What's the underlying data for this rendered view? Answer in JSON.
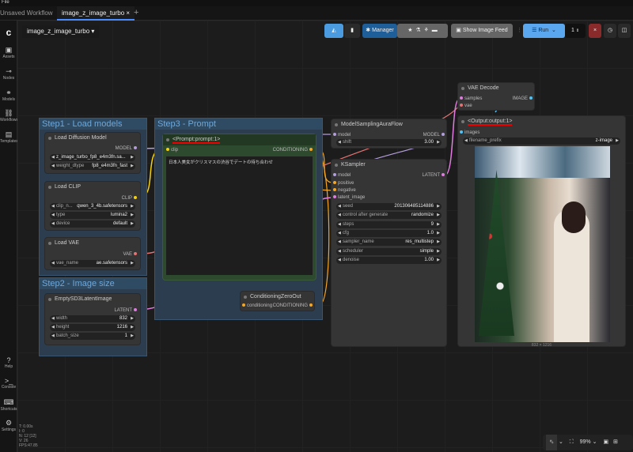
{
  "titlebar": "File",
  "tabs": [
    {
      "label": "Unsaved Workflow"
    },
    {
      "label": "image_z_image_turbo",
      "close": "×"
    }
  ],
  "new_tab": "+",
  "workflow_name": "image_z_image_turbo",
  "toolbar": {
    "manager": "Manager",
    "show_image_feed": "Show Image Feed",
    "run": "Run",
    "queue_count": "1",
    "close": "×"
  },
  "sidebar": [
    {
      "label": "Assets",
      "icon": "▣"
    },
    {
      "label": "Nodes",
      "icon": "⊸"
    },
    {
      "label": "Models",
      "icon": "⚭"
    },
    {
      "label": "Workflows",
      "icon": "⛓"
    },
    {
      "label": "Templates",
      "icon": "▤"
    }
  ],
  "sidebar_bottom": [
    {
      "label": "Help",
      "icon": "?"
    },
    {
      "label": "Console",
      "icon": ">_"
    },
    {
      "label": "Shortcuts",
      "icon": "⌨"
    },
    {
      "label": "Settings",
      "icon": "⚙"
    }
  ],
  "stats": [
    "T: 0.00s",
    "I: 0",
    "N: 12 [12]",
    "V: 26",
    "FPS:47.85"
  ],
  "groups": {
    "step1": "Step1 - Load models",
    "step2": "Step2 - Image size",
    "step3": "Step3 - Prompt"
  },
  "nodes": {
    "load_diffusion": {
      "title": "Load Diffusion Model",
      "out": "MODEL",
      "w": [
        {
          "l": "",
          "v": "z_image_turbo_fp8_e4m3fn.sa..."
        },
        {
          "l": "weight_dtype",
          "v": "fp8_e4m3fn_fast"
        }
      ]
    },
    "load_clip": {
      "title": "Load CLIP",
      "out": "CLIP",
      "w": [
        {
          "l": "clip_n...",
          "v": "qwen_3_4b.safetensors"
        },
        {
          "l": "type",
          "v": "lumina2"
        },
        {
          "l": "device",
          "v": "default"
        }
      ]
    },
    "load_vae": {
      "title": "Load VAE",
      "out": "VAE",
      "w": [
        {
          "l": "vae_name",
          "v": "ae.safetensors"
        }
      ]
    },
    "latent": {
      "title": "EmptySD3LatentImage",
      "out": "LATENT",
      "w": [
        {
          "l": "width",
          "v": "832"
        },
        {
          "l": "height",
          "v": "1216"
        },
        {
          "l": "batch_size",
          "v": "1"
        }
      ]
    },
    "prompt": {
      "title": "<Prompt:prompt:1>",
      "in": "clip",
      "out": "CONDITIONING",
      "text": "日本人美女がクリスマスの渋谷でデートの待ち合わせ"
    },
    "zero": {
      "title": "ConditioningZeroOut",
      "in": "conditioning",
      "out": "CONDITIONING"
    },
    "aura": {
      "title": "ModelSamplingAuraFlow",
      "in": "model",
      "out": "MODEL",
      "w": [
        {
          "l": "shift",
          "v": "3.00"
        }
      ]
    },
    "ksampler": {
      "title": "KSampler",
      "in": [
        "model",
        "positive",
        "negative",
        "latent_image"
      ],
      "out": "LATENT",
      "w": [
        {
          "l": "seed",
          "v": "201306485114886"
        },
        {
          "l": "control after generate",
          "v": "randomize"
        },
        {
          "l": "steps",
          "v": "9"
        },
        {
          "l": "cfg",
          "v": "1.0"
        },
        {
          "l": "sampler_name",
          "v": "res_multistep"
        },
        {
          "l": "scheduler",
          "v": "simple"
        },
        {
          "l": "denoise",
          "v": "1.00"
        }
      ]
    },
    "vaedecode": {
      "title": "VAE Decode",
      "in": [
        "samples",
        "vae"
      ],
      "out": "IMAGE"
    },
    "output": {
      "title": "<Output:output:1>",
      "in": "images",
      "w": [
        {
          "l": "filename_prefix",
          "v": "z-image"
        }
      ],
      "size": "832 × 1216"
    }
  },
  "zoom": "99%"
}
